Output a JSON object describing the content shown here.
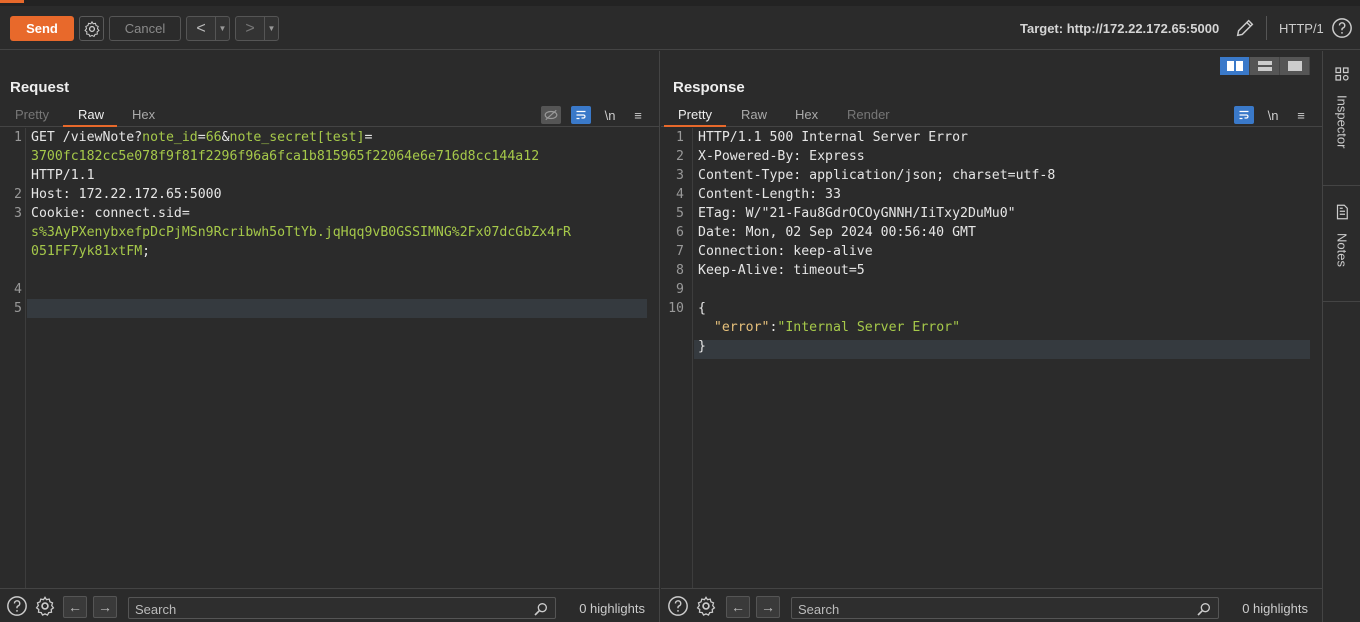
{
  "toolbar": {
    "send_label": "Send",
    "cancel_label": "Cancel",
    "back_glyph": "<",
    "forward_glyph": ">",
    "dropdown_glyph": "▼",
    "target_label": "Target: http://172.22.172.65:5000",
    "protocol": "HTTP/1"
  },
  "request": {
    "title": "Request",
    "tabs": [
      "Pretty",
      "Raw",
      "Hex"
    ],
    "active_tab": "Raw",
    "newline_label": "\\n",
    "lines": [
      {
        "n": "1",
        "parts": [
          [
            "w",
            "GET /viewNote"
          ],
          [
            "w",
            "?"
          ],
          [
            "g",
            "note_id"
          ],
          [
            "w",
            "="
          ],
          [
            "g",
            "66"
          ],
          [
            "w",
            "&"
          ],
          [
            "g",
            "note_secret[test]"
          ],
          [
            "w",
            "="
          ]
        ]
      },
      {
        "n": "",
        "parts": [
          [
            "g",
            "3700fc182cc5e078f9f81f2296f96a6fca1b815965f22064e6e716d8cc144a12"
          ]
        ]
      },
      {
        "n": "",
        "parts": [
          [
            "w",
            "HTTP/1.1"
          ]
        ]
      },
      {
        "n": "2",
        "parts": [
          [
            "w",
            "Host: 172.22.172.65:5000"
          ]
        ]
      },
      {
        "n": "3",
        "parts": [
          [
            "w",
            "Cookie: "
          ],
          [
            "w",
            "connect.sid"
          ],
          [
            "w",
            "="
          ]
        ]
      },
      {
        "n": "",
        "parts": [
          [
            "g",
            "s%3AyPXenybxefpDcPjMSn9Rcribwh5oTtYb.jqHqq9vB0GSSIMNG%2Fx07dcGbZx4rR"
          ]
        ]
      },
      {
        "n": "",
        "parts": [
          [
            "g",
            "051FF7yk81xtFM"
          ],
          [
            "w",
            ";"
          ]
        ]
      },
      {
        "n": "",
        "parts": []
      },
      {
        "n": "4",
        "parts": []
      },
      {
        "n": "5",
        "parts": []
      }
    ],
    "search_placeholder": "Search",
    "highlights": "0 highlights"
  },
  "response": {
    "title": "Response",
    "tabs": [
      "Pretty",
      "Raw",
      "Hex",
      "Render"
    ],
    "active_tab": "Pretty",
    "newline_label": "\\n",
    "lines": [
      {
        "n": "1",
        "parts": [
          [
            "w",
            "HTTP/1.1 500 Internal Server Error"
          ]
        ]
      },
      {
        "n": "2",
        "parts": [
          [
            "w",
            "X-Powered-By: Express"
          ]
        ]
      },
      {
        "n": "3",
        "parts": [
          [
            "w",
            "Content-Type: application/json; charset=utf-8"
          ]
        ]
      },
      {
        "n": "4",
        "parts": [
          [
            "w",
            "Content-Length: 33"
          ]
        ]
      },
      {
        "n": "5",
        "parts": [
          [
            "w",
            "ETag: W/\"21-Fau8GdrOCOyGNNH/IiTxy2DuMu0\""
          ]
        ]
      },
      {
        "n": "6",
        "parts": [
          [
            "w",
            "Date: Mon, 02 Sep 2024 00:56:40 GMT"
          ]
        ]
      },
      {
        "n": "7",
        "parts": [
          [
            "w",
            "Connection: keep-alive"
          ]
        ]
      },
      {
        "n": "8",
        "parts": [
          [
            "w",
            "Keep-Alive: timeout=5"
          ]
        ]
      },
      {
        "n": "9",
        "parts": []
      },
      {
        "n": "10",
        "parts": [
          [
            "w",
            "{"
          ]
        ]
      },
      {
        "n": "",
        "parts": [
          [
            "w",
            "  "
          ],
          [
            "k",
            "\"error\""
          ],
          [
            "w",
            ":"
          ],
          [
            "g",
            "\"Internal Server Error\""
          ]
        ]
      },
      {
        "n": "",
        "parts": [
          [
            "w",
            "}"
          ]
        ]
      }
    ],
    "search_placeholder": "Search",
    "highlights": "0 highlights"
  },
  "rail": {
    "inspector_label": "Inspector",
    "notes_label": "Notes"
  },
  "colors": {
    "accent": "#e8692b",
    "selection_blue": "#3a79c9",
    "param_green": "#a6c94a"
  }
}
